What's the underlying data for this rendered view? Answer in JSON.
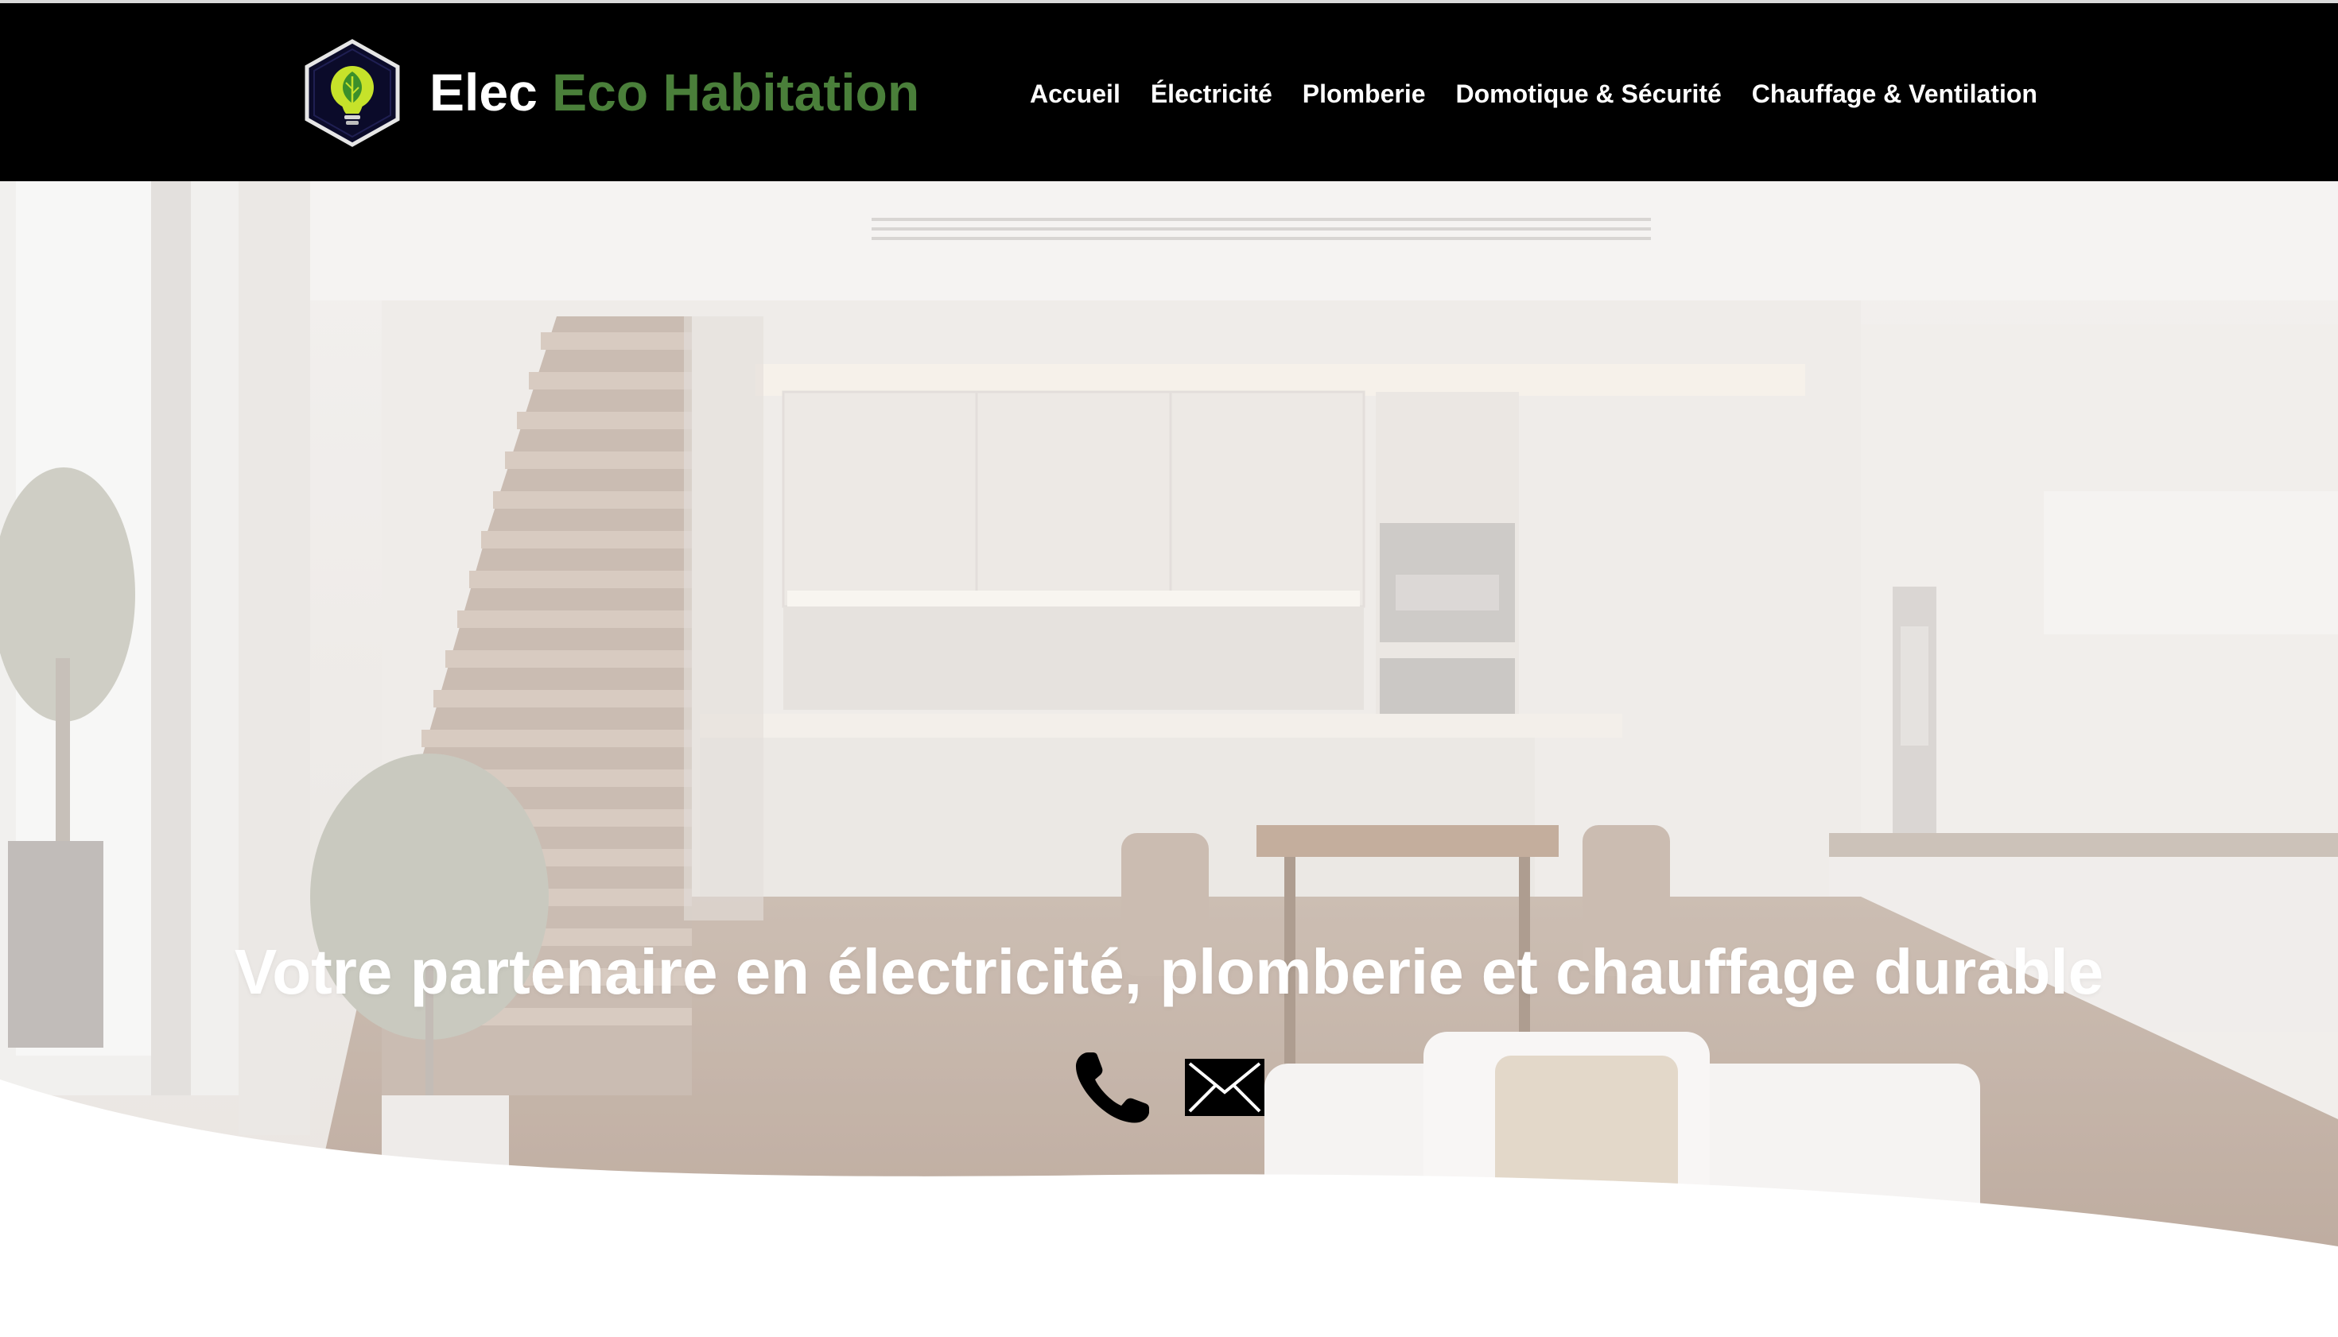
{
  "brand": {
    "name_part1": "Elec",
    "name_part2": "Eco Habitation",
    "logo_icon": "lightbulb-leaf-icon",
    "colors": {
      "accent_green": "#4a7f3a",
      "nav_bg": "#000000"
    }
  },
  "nav": {
    "items": [
      {
        "label": "Accueil"
      },
      {
        "label": "Électricité"
      },
      {
        "label": "Plomberie"
      },
      {
        "label": "Domotique & Sécurité"
      },
      {
        "label": "Chauffage & Ventilation"
      }
    ]
  },
  "hero": {
    "title": "Votre partenaire en électricité, plomberie et chauffage durable",
    "icons": [
      "phone-icon",
      "mail-icon"
    ]
  }
}
